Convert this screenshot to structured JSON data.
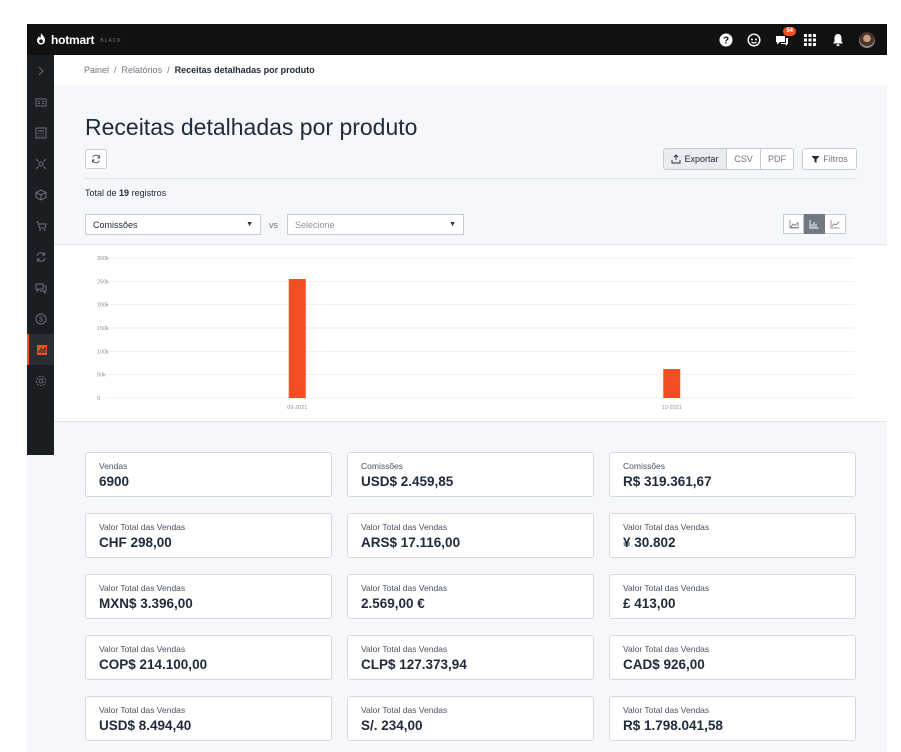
{
  "app": {
    "logo_text": "hotmart",
    "logo_sub": "BLACK",
    "notification_count": "54"
  },
  "topbar": {
    "icons": [
      "help-icon",
      "support-icon",
      "chat-icon",
      "apps-grid-icon",
      "bell-icon"
    ]
  },
  "sidebar": {
    "items": [
      "chevron-right-icon",
      "dashboard-icon",
      "calculator-icon",
      "affiliate-icon",
      "product-box-icon",
      "cart-icon",
      "recurrence-icon",
      "messages-icon",
      "money-icon",
      "reports-icon",
      "settings-icon"
    ],
    "active_index": 9
  },
  "breadcrumb": {
    "root": "Painel",
    "sep1": "/",
    "mid": "Relatórios",
    "sep2": "/",
    "current": "Receitas detalhadas por produto"
  },
  "page": {
    "title": "Receitas detalhadas por produto"
  },
  "toolbar": {
    "export_label": "Exportar",
    "csv_label": "CSV",
    "pdf_label": "PDF",
    "filters_label": "Filtros"
  },
  "summary": {
    "prefix": "Total de",
    "count": "19",
    "suffix": "registros"
  },
  "selects": {
    "primary": "Comissões",
    "vs": "vs",
    "secondary_placeholder": "Selecione"
  },
  "chart_types": {
    "active_index": 1,
    "items": [
      "area-chart-icon",
      "bar-chart-icon",
      "line-chart-icon"
    ]
  },
  "chart_data": {
    "type": "bar",
    "categories": [
      "09-2021",
      "10-2021"
    ],
    "values": [
      255000,
      62000
    ],
    "yticks": [
      "0",
      "50k",
      "100k",
      "150k",
      "200k",
      "250k",
      "300k"
    ],
    "ylim": [
      0,
      300000
    ],
    "bar_color": "#f04e23",
    "grid": true,
    "title": "",
    "xlabel": "",
    "ylabel": ""
  },
  "cards": [
    {
      "label": "Vendas",
      "value": "6900"
    },
    {
      "label": "Comissões",
      "value": "USD$ 2.459,85"
    },
    {
      "label": "Comissões",
      "value": "R$ 319.361,67"
    },
    {
      "label": "Valor Total das Vendas",
      "value": "CHF 298,00"
    },
    {
      "label": "Valor Total das Vendas",
      "value": "ARS$ 17.116,00"
    },
    {
      "label": "Valor Total das Vendas",
      "value": "¥ 30.802"
    },
    {
      "label": "Valor Total das Vendas",
      "value": "MXN$ 3.396,00"
    },
    {
      "label": "Valor Total das Vendas",
      "value": "2.569,00 €"
    },
    {
      "label": "Valor Total das Vendas",
      "value": "£ 413,00"
    },
    {
      "label": "Valor Total das Vendas",
      "value": "COP$ 214.100,00"
    },
    {
      "label": "Valor Total das Vendas",
      "value": "CLP$ 127.373,94"
    },
    {
      "label": "Valor Total das Vendas",
      "value": "CAD$ 926,00"
    },
    {
      "label": "Valor Total das Vendas",
      "value": "USD$ 8.494,40"
    },
    {
      "label": "Valor Total das Vendas",
      "value": "S/. 234,00"
    },
    {
      "label": "Valor Total das Vendas",
      "value": "R$ 1.798.041,58"
    }
  ],
  "colors": {
    "accent": "#f04e23",
    "topbar": "#111111",
    "sidebar": "#1a1d21"
  }
}
